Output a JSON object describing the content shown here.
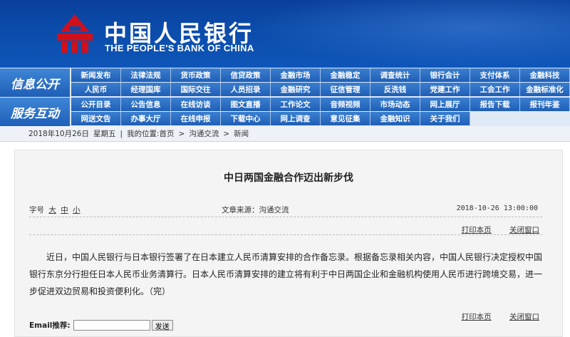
{
  "header": {
    "title_cn": "中国人民银行",
    "title_en": "THE PEOPLE'S BANK OF CHINA",
    "logo_icon": "pboc-emblem-icon",
    "colors": {
      "primary": "#0b4aa8",
      "emblem": "#d0101b"
    }
  },
  "nav": {
    "section1": "信息公开",
    "section2": "服务互动",
    "row1": [
      "新闻发布",
      "法律法规",
      "货币政策",
      "信贷政策",
      "金融市场",
      "金融稳定",
      "调查统计",
      "银行会计",
      "支付体系",
      "金融科技"
    ],
    "row2": [
      "人民币",
      "经理国库",
      "国际交往",
      "人员招录",
      "金融研究",
      "征信管理",
      "反洗钱",
      "党建工作",
      "工会工作",
      "金融标准化"
    ],
    "row3": [
      "公开目录",
      "公告信息",
      "在线访谈",
      "图文直播",
      "工作论文",
      "音频视频",
      "市场动态",
      "网上展厅",
      "报告下载",
      "报刊年鉴"
    ],
    "row4": [
      "网送文告",
      "办事大厅",
      "在线申报",
      "下载中心",
      "网上调查",
      "意见征集",
      "金融知识",
      "关于我们"
    ]
  },
  "breadcrumb": {
    "date": "2018年10月26日",
    "weekday": "星期五",
    "prefix": "我的位置:",
    "home": "首页",
    "sep": ">",
    "level1": "沟通交流",
    "level2": "新闻"
  },
  "article": {
    "title": "中日两国金融合作迈出新步伐",
    "fontsize_label": "字号",
    "font_large": "大",
    "font_medium": "中",
    "font_small": "小",
    "source": "文章来源：沟通交流",
    "datetime": "2018-10-26  13:00:00",
    "print_label": "打印本页",
    "close_label": "关闭窗口",
    "body": "近日，中国人民银行与日本银行签署了在日本建立人民币清算安排的合作备忘录。根据备忘录相关内容，中国人民银行决定授权中国银行东京分行担任日本人民币业务清算行。日本人民币清算安排的建立将有利于中日两国企业和金融机构使用人民币进行跨境交易，进一步促进双边贸易和投资便利化。（完）",
    "email_label": "Email推荐:",
    "email_value": "",
    "send_label": "发送"
  }
}
